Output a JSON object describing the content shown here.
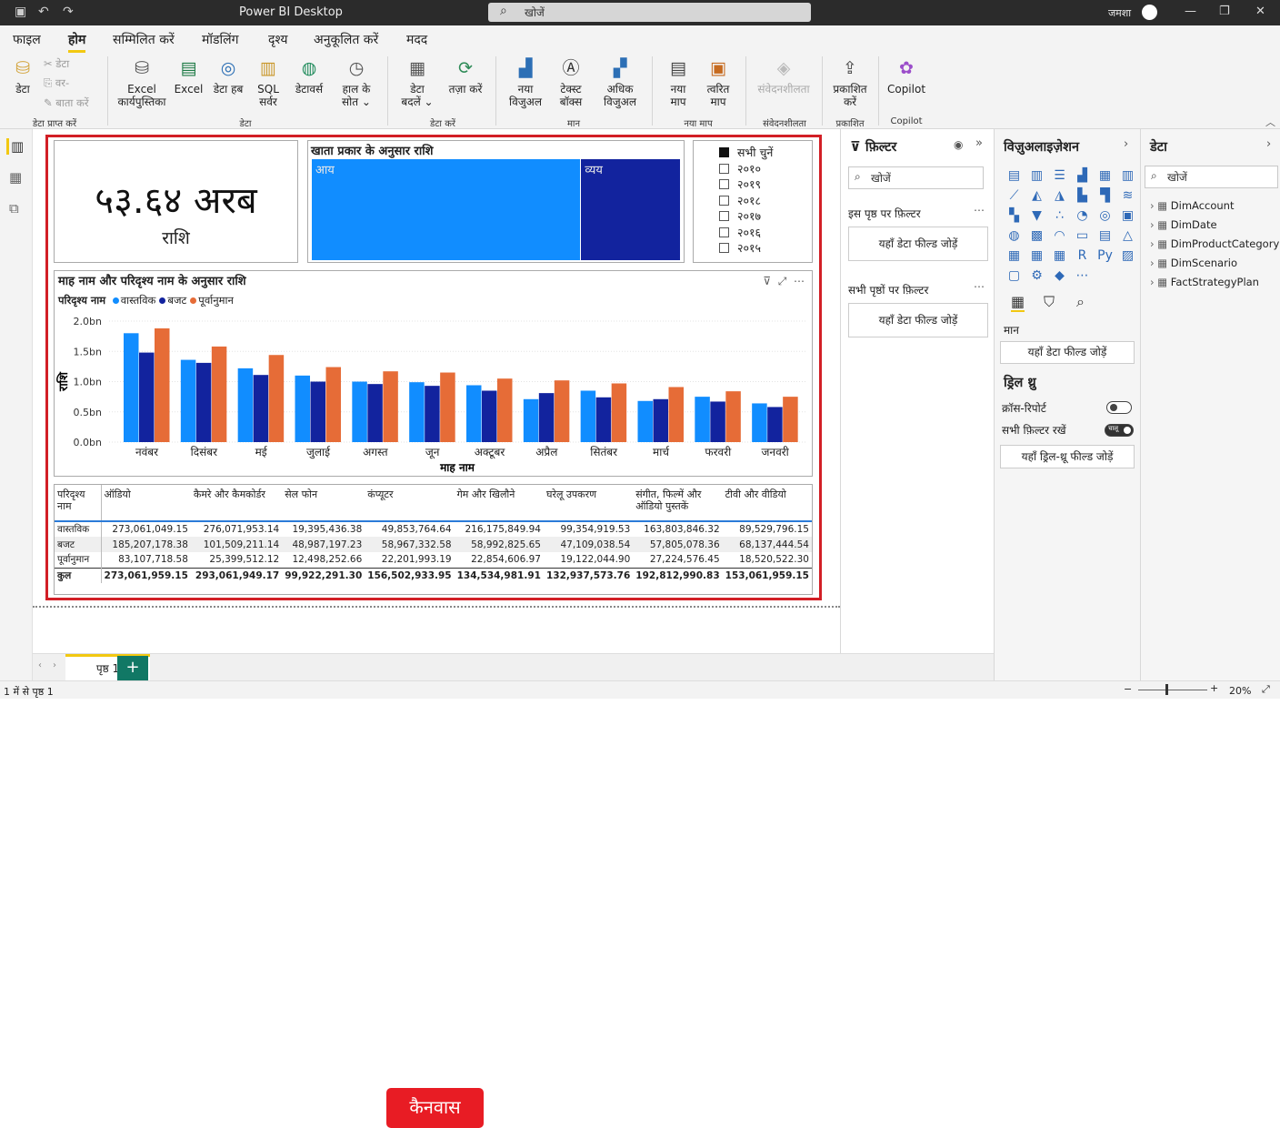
{
  "titlebar": {
    "title": "Power BI Desktop",
    "search_placeholder": "खोजें",
    "user": "जमशा"
  },
  "menu": [
    "फाइल",
    "होम",
    "सम्मिलित करें",
    "मॉडलिंग",
    "दृश्य",
    "अनुकूलित करें",
    "मदद"
  ],
  "ribbon": {
    "data": "डेटा",
    "cut": "डेटा",
    "copy": "वर-",
    "format_painter": "बाता करें",
    "excel_workbook": "Excel\nकार्यपुस्तिका",
    "excel": "Excel",
    "data_hub": "डेटा हब",
    "sql": "SQL\nसर्वर",
    "dataverse": "डेटावर्स",
    "recent_sources": "हाल के\nसोत ⌄",
    "transform": "डेटा\nबदलें ⌄",
    "refresh": "तज़ा करें",
    "new_visual": "नया\nविजुअल",
    "text_box": "टेक्स्ट\nबॉक्स",
    "more_visuals": "अधिक\nविजुअल",
    "new_measure": "नया\nमाप",
    "quick_measure": "त्वरित\nमाप",
    "sensitivity": "संवेदनशीलता",
    "publish": "प्रकाशित\nकरें",
    "copilot": "Copilot",
    "groups": {
      "get_data": "डेटा प्राप्त करें",
      "data": "डेटा",
      "queries": "डेटा करें",
      "insert": "मान",
      "calc": "नया माप",
      "sens": "संवेदनशीलता",
      "share": "प्रकाशित",
      "copilot": "Copilot"
    }
  },
  "card": {
    "value": "५३.६४ अरब",
    "label": "राशि"
  },
  "treemap": {
    "title": "खाता प्रकार के अनुसार राशि",
    "tiles": [
      {
        "label": "आय",
        "share": 0.73
      },
      {
        "label": "व्यय",
        "share": 0.27
      }
    ],
    "colors": [
      "#118dff",
      "#12239e"
    ]
  },
  "slicer": {
    "items": [
      {
        "label": "सभी चुनें",
        "checked": true
      },
      {
        "label": "२०१०",
        "checked": false
      },
      {
        "label": "२०१९",
        "checked": false
      },
      {
        "label": "२०१८",
        "checked": false
      },
      {
        "label": "२०१७",
        "checked": false
      },
      {
        "label": "२०१६",
        "checked": false
      },
      {
        "label": "२०१५",
        "checked": false
      }
    ]
  },
  "chart_data": {
    "type": "bar",
    "title": "माह नाम और परिदृश्य नाम के अनुसार राशि",
    "legend_title": "परिदृश्य नाम",
    "xlabel": "माह नाम",
    "ylabel": "राशि",
    "ylim": [
      0,
      2.0
    ],
    "yticks": [
      "0.0bn",
      "0.5bn",
      "1.0bn",
      "1.5bn",
      "2.0bn"
    ],
    "categories": [
      "नवंबर",
      "दिसंबर",
      "मई",
      "जुलाई",
      "अगस्त",
      "जून",
      "अक्टूबर",
      "अप्रैल",
      "सितंबर",
      "मार्च",
      "फरवरी",
      "जनवरी"
    ],
    "series": [
      {
        "name": "वास्तविक",
        "color": "#118dff",
        "values": [
          1.8,
          1.36,
          1.22,
          1.1,
          1.0,
          0.99,
          0.94,
          0.71,
          0.85,
          0.68,
          0.75,
          0.64
        ]
      },
      {
        "name": "बजट",
        "color": "#12239e",
        "values": [
          1.48,
          1.31,
          1.11,
          1.0,
          0.96,
          0.93,
          0.85,
          0.81,
          0.74,
          0.71,
          0.67,
          0.58
        ]
      },
      {
        "name": "पूर्वानुमान",
        "color": "#e66c37",
        "values": [
          1.88,
          1.58,
          1.44,
          1.24,
          1.17,
          1.15,
          1.05,
          1.02,
          0.97,
          0.91,
          0.84,
          0.75
        ]
      }
    ],
    "legend_position": "top-left",
    "grid": true
  },
  "matrix": {
    "header": [
      "परिदृश्य नाम",
      "ऑडियो",
      "कैमरे और कैमकोर्डर",
      "सेल फोन",
      "कंप्यूटर",
      "गेम और खिलौने",
      "घरेलू उपकरण",
      "संगीत, फिल्में और ऑडियो पुस्तकें",
      "टीवी और वीडियो"
    ],
    "rows": [
      [
        "वास्तविक",
        "273,061,049.15",
        "276,071,953.14",
        "19,395,436.38",
        "49,853,764.64",
        "216,175,849.94",
        "99,354,919.53",
        "163,803,846.32",
        "89,529,796.15"
      ],
      [
        "बजट",
        "185,207,178.38",
        "101,509,211.14",
        "48,987,197.23",
        "58,967,332.58",
        "58,992,825.65",
        "47,109,038.54",
        "57,805,078.36",
        "68,137,444.54"
      ],
      [
        "पूर्वानुमान",
        "83,107,718.58",
        "25,399,512.12",
        "12,498,252.66",
        "22,201,993.19",
        "22,854,606.97",
        "19,122,044.90",
        "27,224,576.45",
        "18,520,522.30"
      ],
      [
        "कुल",
        "273,061,959.15",
        "293,061,949.17",
        "99,922,291.30",
        "156,502,933.95",
        "134,534,981.91",
        "132,937,573.76",
        "192,812,990.83",
        "153,061,959.15"
      ]
    ]
  },
  "canvas_label": "कैनवास",
  "filters": {
    "title": "फ़िल्टर",
    "search": "खोजें",
    "page_filters": "इस पृष्ठ पर फ़िल्टर",
    "all_filters": "सभी पृष्ठों पर फ़िल्टर",
    "drop": "यहाँ डेटा फील्ड जोड़ें"
  },
  "viz": {
    "title": "विज़ुअलाइज़ेशन",
    "values": "मान",
    "values_drop": "यहाँ डेटा फील्ड जोड़ें",
    "drill": "ड्रिल थ्रु",
    "cross_report": "क्रॉस-रिपोर्ट",
    "keep_filters": "सभी फ़िल्टर रखें",
    "keep_toggle": "चालू",
    "drill_drop": "यहाँ ड्रिल-थ्रू फील्ड जोड़ें"
  },
  "data": {
    "title": "डेटा",
    "search": "खोजें",
    "tables": [
      "DimAccount",
      "DimDate",
      "DimProductCategory",
      "DimScenario",
      "FactStrategyPlan"
    ]
  },
  "pages": {
    "tab": "पृष्ठ 1",
    "add": "+"
  },
  "status": {
    "page": "1 में से पृष्ठ 1",
    "zoom": "20%"
  }
}
